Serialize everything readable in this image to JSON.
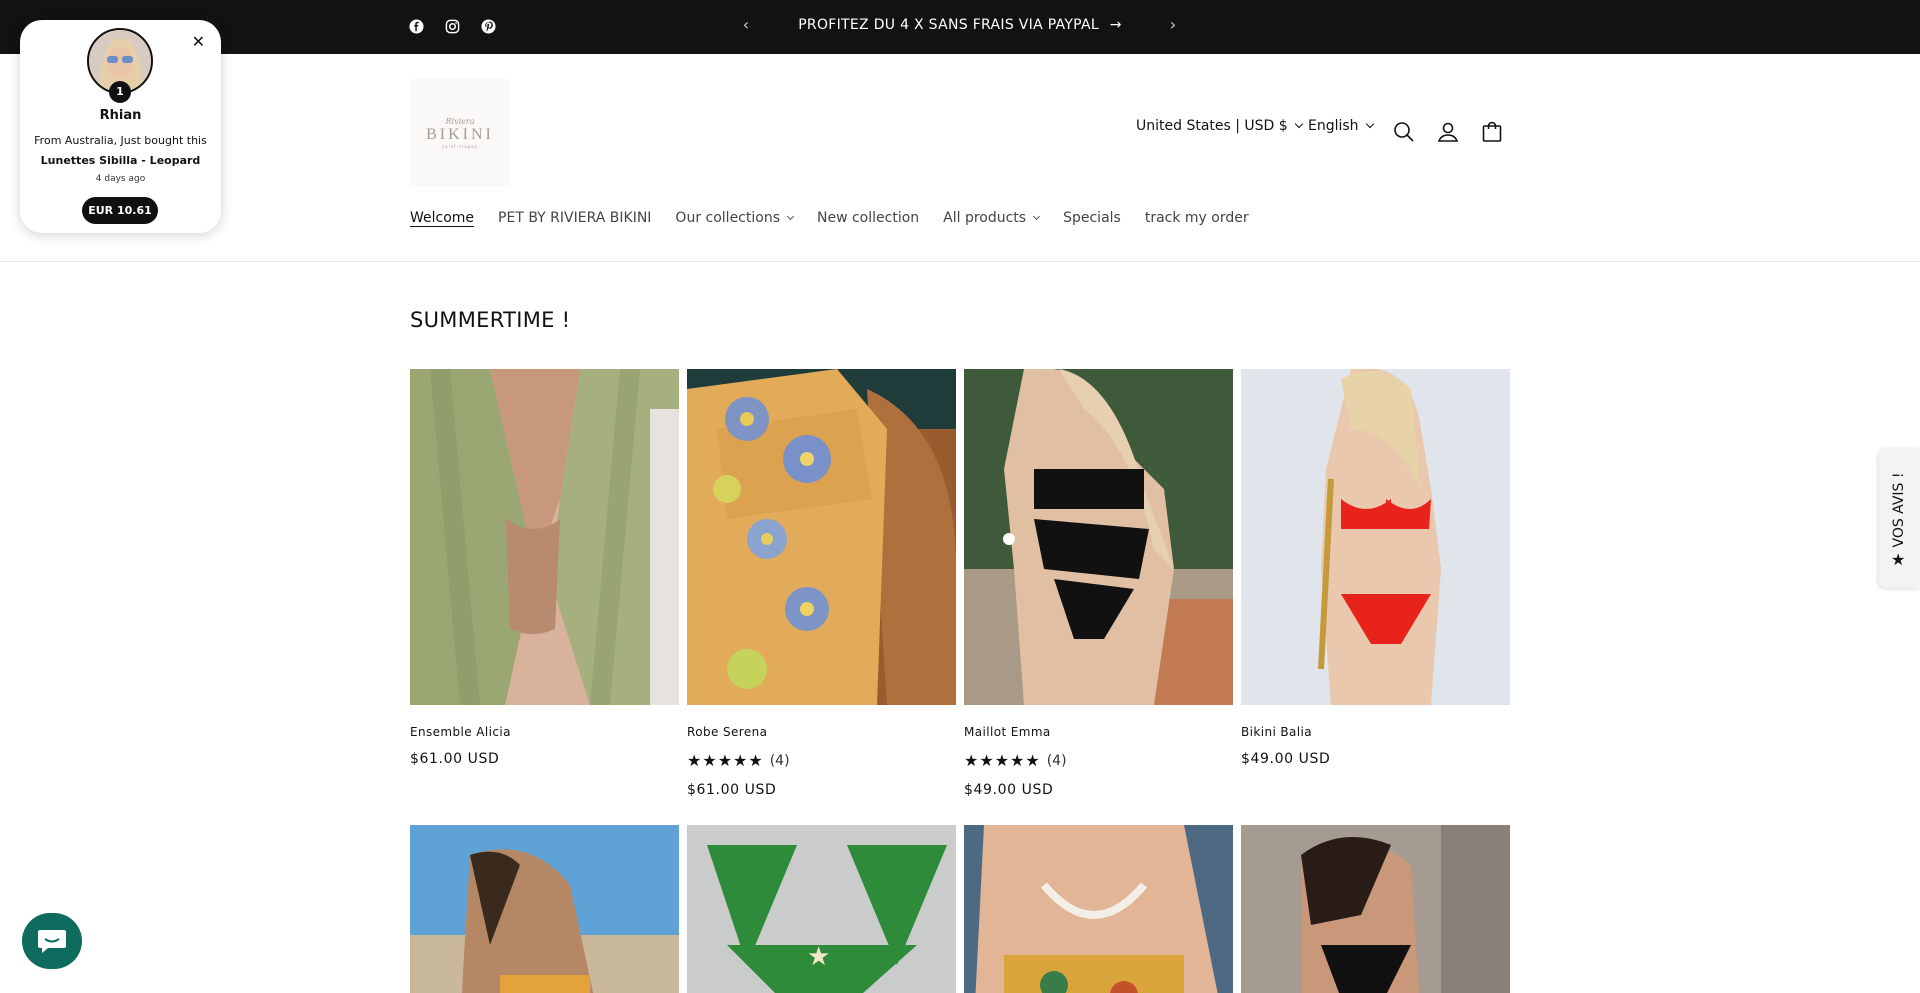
{
  "announcement": {
    "message": "PROFITEZ DU 4 X SANS FRAIS VIA PAYPAL",
    "arrow": "→",
    "prev": "‹",
    "next": "›",
    "social_icons": [
      "facebook-icon",
      "instagram-icon",
      "pinterest-icon"
    ]
  },
  "header": {
    "logo": {
      "script": "Riviera",
      "word": "BIKINI",
      "small": "saint-tropez"
    },
    "country_selector": "United States | USD $",
    "language_selector": "English",
    "icons": [
      "search-icon",
      "account-icon",
      "cart-icon"
    ]
  },
  "nav": {
    "items": [
      {
        "label": "Welcome",
        "active": true,
        "dropdown": false
      },
      {
        "label": "PET BY RIVIERA BIKINI",
        "active": false,
        "dropdown": false
      },
      {
        "label": "Our collections",
        "active": false,
        "dropdown": true
      },
      {
        "label": "New collection",
        "active": false,
        "dropdown": false
      },
      {
        "label": "All products",
        "active": false,
        "dropdown": true
      },
      {
        "label": "Specials",
        "active": false,
        "dropdown": false
      },
      {
        "label": "track my order",
        "active": false,
        "dropdown": false
      }
    ]
  },
  "collection": {
    "title": "SUMMERTIME !",
    "products": [
      {
        "name": "Ensemble Alicia",
        "price": "$61.00 USD",
        "stars": "",
        "reviews": ""
      },
      {
        "name": "Robe Serena",
        "price": "$61.00 USD",
        "stars": "★★★★★",
        "reviews": "(4)"
      },
      {
        "name": "Maillot Emma",
        "price": "$49.00 USD",
        "stars": "★★★★★",
        "reviews": "(4)"
      },
      {
        "name": "Bikini Balia",
        "price": "$49.00 USD",
        "stars": "",
        "reviews": ""
      }
    ]
  },
  "purchase_popup": {
    "count": "1",
    "name": "Rhian",
    "from_text": "From Australia, Just bought this",
    "product": "Lunettes Sibilla - Leopard",
    "time": "4 days ago",
    "price": "EUR 10.61",
    "close": "✕"
  },
  "reviews_tab": {
    "label": "VOS AVIS !",
    "icon": "★"
  },
  "colors": {
    "bar": "#121212",
    "chat": "#0f6b5e",
    "text": "#121212"
  }
}
